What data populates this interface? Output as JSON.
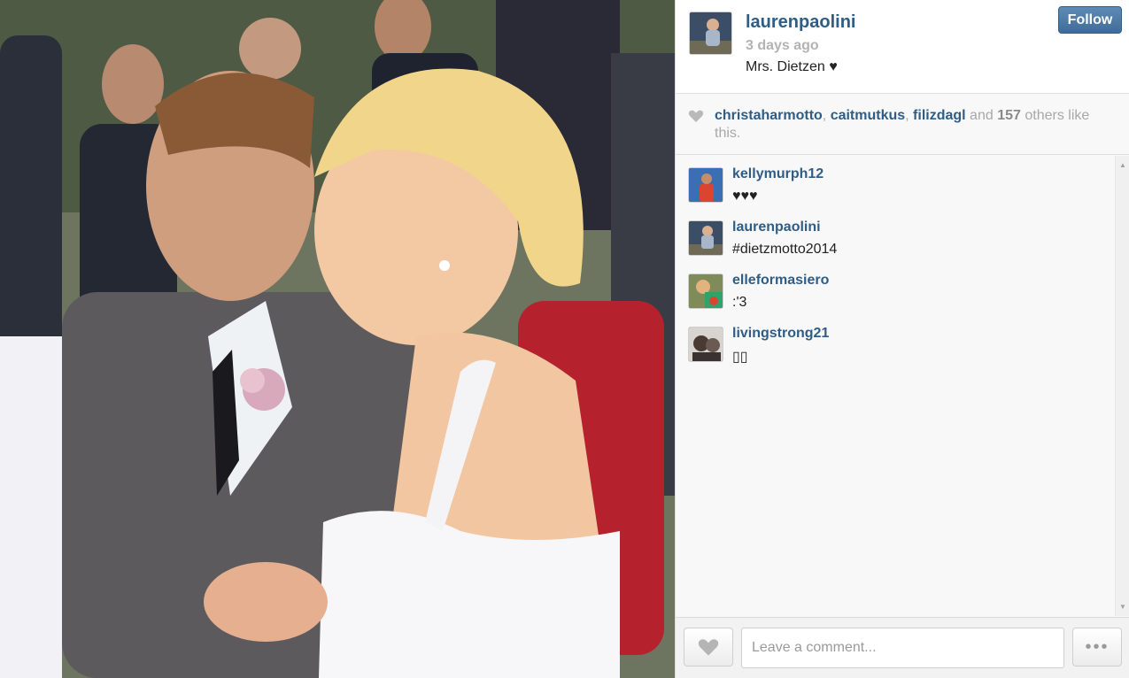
{
  "post": {
    "owner": "laurenpaolini",
    "time": "3 days ago",
    "caption": "Mrs. Dietzen ♥",
    "follow_label": "Follow"
  },
  "likes": {
    "users": [
      "christaharmotto",
      "caitmutkus",
      "filizdagl"
    ],
    "sep1": ", ",
    "sep2": ", ",
    "and_text": " and ",
    "others_count": "157",
    "tail": " others like this."
  },
  "comments": [
    {
      "user": "kellymurph12",
      "text": "♥♥♥"
    },
    {
      "user": "laurenpaolini",
      "text": "#dietzmotto2014"
    },
    {
      "user": "elleformasiero",
      "text": ":'3"
    },
    {
      "user": "livingstrong21",
      "text": "▯▯"
    }
  ],
  "footer": {
    "comment_placeholder": "Leave a comment...",
    "more_label": "•••"
  },
  "icons": {
    "heart": "heart-icon",
    "more": "more-icon",
    "scroll_up": "scroll-up-icon",
    "scroll_down": "scroll-down-icon"
  },
  "colors": {
    "username": "#2f5d85",
    "follow_button": "#4a78a5",
    "muted": "#a8a8a8"
  }
}
